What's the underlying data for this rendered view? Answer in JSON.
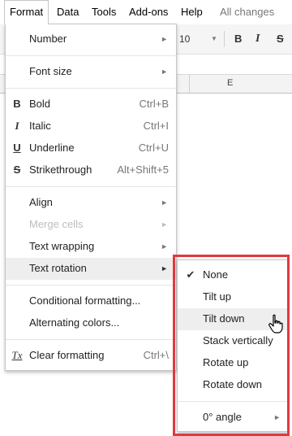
{
  "menubar": {
    "items": [
      "Format",
      "Data",
      "Tools",
      "Add-ons",
      "Help"
    ],
    "status": "All changes sav"
  },
  "toolbar": {
    "font_size": "10",
    "bold": "B",
    "italic": "I",
    "strike": "S"
  },
  "grid": {
    "column_letter": "E"
  },
  "format_menu": {
    "number": "Number",
    "font_size": "Font size",
    "bold": "Bold",
    "bold_shortcut": "Ctrl+B",
    "italic": "Italic",
    "italic_shortcut": "Ctrl+I",
    "underline": "Underline",
    "underline_shortcut": "Ctrl+U",
    "strikethrough": "Strikethrough",
    "strikethrough_shortcut": "Alt+Shift+5",
    "align": "Align",
    "merge_cells": "Merge cells",
    "text_wrapping": "Text wrapping",
    "text_rotation": "Text rotation",
    "conditional_formatting": "Conditional formatting...",
    "alternating_colors": "Alternating colors...",
    "clear_formatting": "Clear formatting",
    "clear_formatting_shortcut": "Ctrl+\\",
    "icons": {
      "bold": "B",
      "italic": "I",
      "underline": "U",
      "strikethrough": "S",
      "clear": "Tx"
    }
  },
  "text_rotation_menu": {
    "items": [
      "None",
      "Tilt up",
      "Tilt down",
      "Stack vertically",
      "Rotate up",
      "Rotate down"
    ],
    "selected": "None",
    "hovered": "Tilt down",
    "angle": "0° angle"
  },
  "colors": {
    "highlight_border": "#e0393e",
    "menu_hover": "#eeeeee"
  }
}
